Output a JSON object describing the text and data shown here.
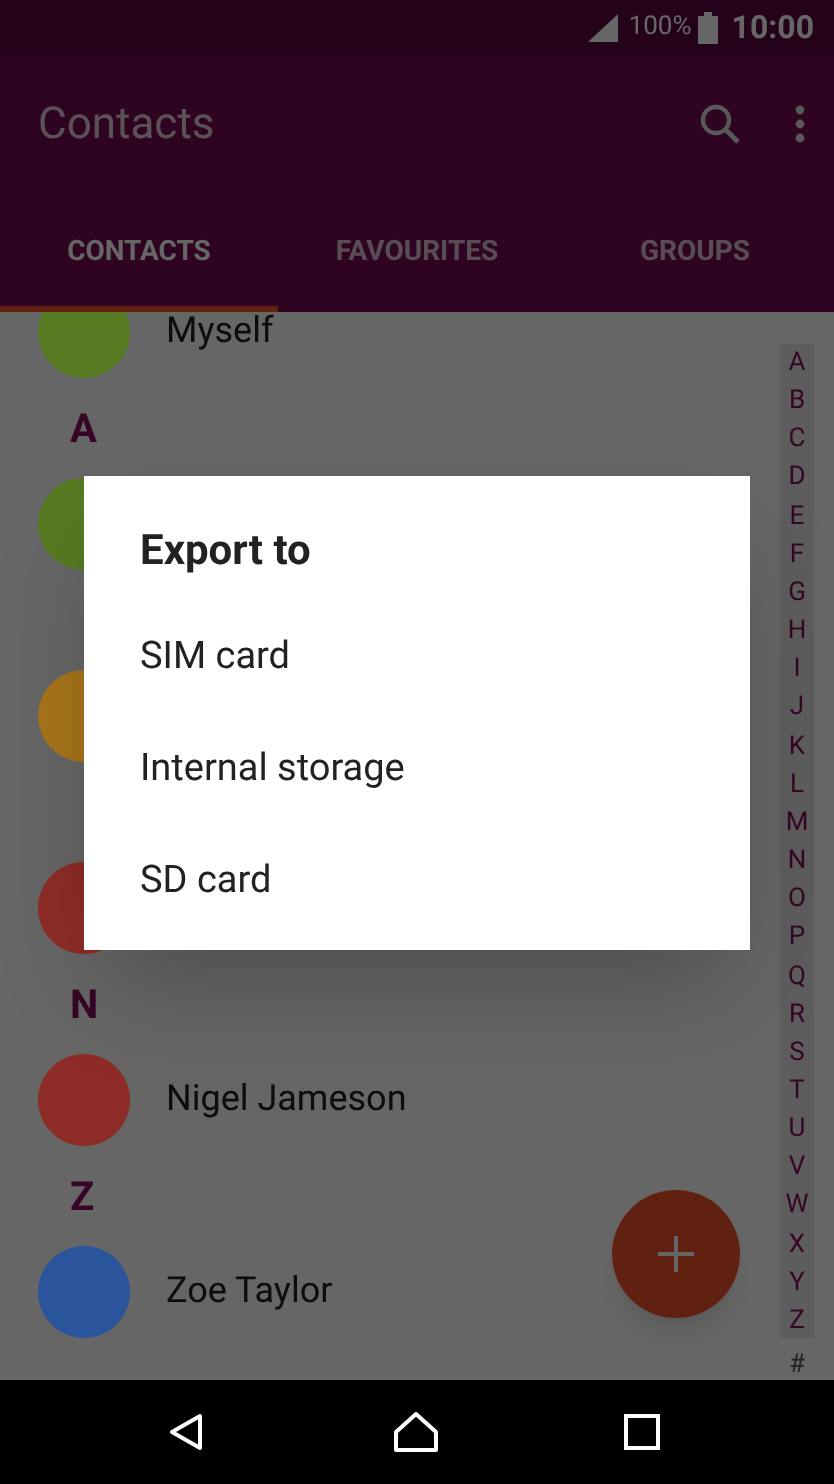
{
  "status_bar": {
    "battery": "100%",
    "time": "10:00"
  },
  "toolbar": {
    "title": "Contacts"
  },
  "tabs": [
    {
      "label": "CONTACTS",
      "selected": true
    },
    {
      "label": "FAVOURITES",
      "selected": false
    },
    {
      "label": "GROUPS",
      "selected": false
    }
  ],
  "contacts": [
    {
      "kind": "contact",
      "name": "Myself",
      "color": "#557a22"
    },
    {
      "kind": "header",
      "letter": "A"
    },
    {
      "kind": "contact",
      "color": "#557a22"
    },
    {
      "kind": "header"
    },
    {
      "kind": "contact",
      "color": "#a7741a"
    },
    {
      "kind": "header"
    },
    {
      "kind": "contact",
      "color": "#8e2c27"
    },
    {
      "kind": "header",
      "letter": "N"
    },
    {
      "kind": "contact",
      "name": "Nigel Jameson",
      "color": "#8e2c27"
    },
    {
      "kind": "header",
      "letter": "Z"
    },
    {
      "kind": "contact",
      "name": "Zoe Taylor",
      "color": "#2a559c"
    }
  ],
  "index": [
    "A",
    "B",
    "C",
    "D",
    "E",
    "F",
    "G",
    "H",
    "I",
    "J",
    "K",
    "L",
    "M",
    "N",
    "O",
    "P",
    "Q",
    "R",
    "S",
    "T",
    "U",
    "V",
    "W",
    "X",
    "Y",
    "Z",
    "#"
  ],
  "dialog": {
    "title": "Export to",
    "options": [
      "SIM card",
      "Internal storage",
      "SD card"
    ]
  }
}
